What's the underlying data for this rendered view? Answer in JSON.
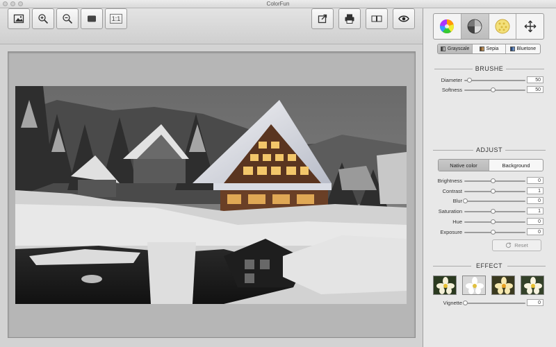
{
  "window": {
    "title": "ColorFun"
  },
  "toolbar": {
    "left_buttons": [
      {
        "name": "open-image-button",
        "icon": "image-icon"
      },
      {
        "name": "zoom-in-button",
        "icon": "zoom-in-icon"
      },
      {
        "name": "zoom-out-button",
        "icon": "zoom-out-icon"
      },
      {
        "name": "fit-screen-button",
        "icon": "fit-screen-icon"
      },
      {
        "name": "actual-size-button",
        "icon": "actual-size-icon",
        "label": "1:1"
      }
    ],
    "right_buttons": [
      {
        "name": "share-button",
        "icon": "share-icon"
      },
      {
        "name": "print-button",
        "icon": "print-icon"
      },
      {
        "name": "compare-button",
        "icon": "compare-icon"
      },
      {
        "name": "preview-button",
        "icon": "eye-icon"
      }
    ]
  },
  "panel": {
    "tabs": [
      {
        "name": "color-wheel-tab",
        "icon": "color-wheel-icon",
        "active": false
      },
      {
        "name": "tone-tab",
        "icon": "tone-icon",
        "active": true
      },
      {
        "name": "pattern-tab",
        "icon": "pattern-icon",
        "active": false
      },
      {
        "name": "move-tab",
        "icon": "move-icon",
        "active": false
      }
    ],
    "modes": [
      {
        "label": "Grayscale",
        "color": "#888888",
        "active": true
      },
      {
        "label": "Sepia",
        "color": "#b07a3a",
        "active": false
      },
      {
        "label": "Bluetone",
        "color": "#2f5ea8",
        "active": false
      }
    ],
    "brush": {
      "title": "BRUSHE",
      "diameter": {
        "label": "Diameter",
        "value": "50",
        "level": 0.08
      },
      "softness": {
        "label": "Softness",
        "value": "50",
        "level": 0.5
      }
    },
    "adjust": {
      "title": "ADJUST",
      "native_label": "Native color",
      "background_label": "Background",
      "rows": [
        {
          "label": "Brightness",
          "value": "0",
          "level": 0.5
        },
        {
          "label": "Contrast",
          "value": "1",
          "level": 0.5
        },
        {
          "label": "Blur",
          "value": "0",
          "level": 0.0
        },
        {
          "label": "Saturation",
          "value": "1",
          "level": 0.5
        },
        {
          "label": "Hue",
          "value": "0",
          "level": 0.5
        },
        {
          "label": "Exposure",
          "value": "0",
          "level": 0.5
        }
      ],
      "reset_label": "Reset"
    },
    "effect": {
      "title": "EFFECT",
      "thumb_count": 4,
      "vignette": {
        "label": "Vignette",
        "value": "0",
        "level": 0.0
      }
    }
  }
}
